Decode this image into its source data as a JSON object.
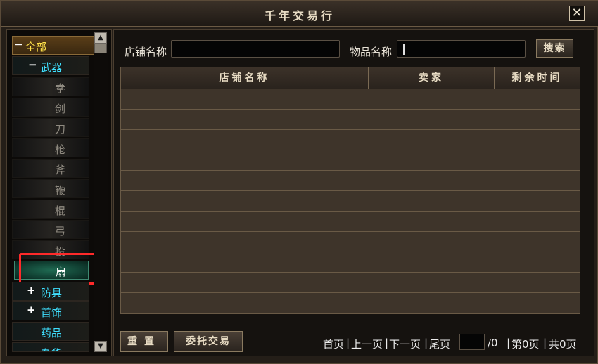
{
  "window": {
    "title": "千年交易行",
    "close_symbol": "✕"
  },
  "sidebar": {
    "items": [
      {
        "label": "全部",
        "toggle": "−"
      },
      {
        "label": "武器",
        "toggle": "−"
      },
      {
        "label": "拳"
      },
      {
        "label": "剑"
      },
      {
        "label": "刀"
      },
      {
        "label": "枪"
      },
      {
        "label": "斧"
      },
      {
        "label": "鞭"
      },
      {
        "label": "棍"
      },
      {
        "label": "弓"
      },
      {
        "label": "投"
      },
      {
        "label": "扇"
      },
      {
        "label": "防具",
        "toggle": "+"
      },
      {
        "label": "首饰",
        "toggle": "+"
      },
      {
        "label": "药品"
      },
      {
        "label": "杂货"
      }
    ],
    "selected": "扇",
    "scroll_up": "▲",
    "scroll_down": "▼"
  },
  "search": {
    "shop_label": "店铺名称",
    "shop_value": "",
    "item_label": "物品名称",
    "item_value": "",
    "search_button": "搜索"
  },
  "table": {
    "columns": [
      "店铺名称",
      "卖家",
      "剩余时间"
    ],
    "rows": []
  },
  "footer": {
    "reset_button": "重置",
    "consign_button": "委托交易",
    "first_page": "首页",
    "prev_page": "上一页",
    "next_page": "下一页",
    "last_page": "尾页",
    "page_input_value": "",
    "page_total": "/0",
    "current_page": "第0页",
    "total_pages": "共0页"
  },
  "colors": {
    "category": "#3fe0ff",
    "root_category": "#ffe24a",
    "leaf": "#8f8a80",
    "highlight": "#ff2a2a"
  }
}
